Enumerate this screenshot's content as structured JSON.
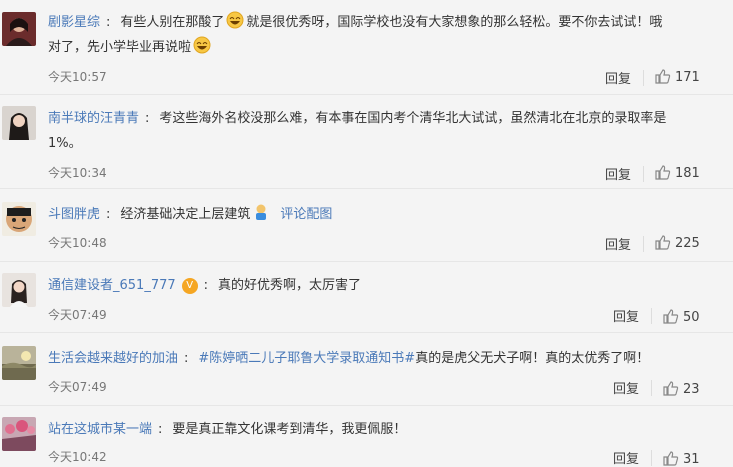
{
  "comments": [
    {
      "user": "剧影星综",
      "text_part1": "有些人别在那酸了",
      "text_part2": "就是很优秀呀，国际学校也没有大家想象的那么轻松。要不你去试试！哦",
      "text_line2": "对了，先小学毕业再说啦",
      "time": "今天10:57",
      "reply": "回复",
      "likes": "171"
    },
    {
      "user": "南半球的汪青青",
      "text_line1": "考这些海外名校没那么难，有本事在国内考个清华北大试试，虽然清北在北京的录取率是",
      "text_line2": "1%。",
      "time": "今天10:34",
      "reply": "回复",
      "likes": "181"
    },
    {
      "user": "斗图胖虎",
      "text": "经济基础决定上层建筑",
      "link": "评论配图",
      "time": "今天10:48",
      "reply": "回复",
      "likes": "225"
    },
    {
      "user": "通信建设者_651_777",
      "badge": "V",
      "text": "真的好优秀啊，太厉害了",
      "time": "今天07:49",
      "reply": "回复",
      "likes": "50"
    },
    {
      "user": "生活会越来越好的加油",
      "hashtag": "#陈婷晒二儿子耶鲁大学录取通知书#",
      "text": "真的是虎父无犬子啊！真的太优秀了啊！",
      "time": "今天07:49",
      "reply": "回复",
      "likes": "23"
    },
    {
      "user": "站在这城市某一端",
      "text": "要是真正靠文化课考到清华，我更佩服！",
      "time": "今天10:42",
      "reply": "回复",
      "likes": "31"
    }
  ],
  "colors": {
    "link": "#4a79b8",
    "text": "#333333",
    "meta": "#777777"
  }
}
